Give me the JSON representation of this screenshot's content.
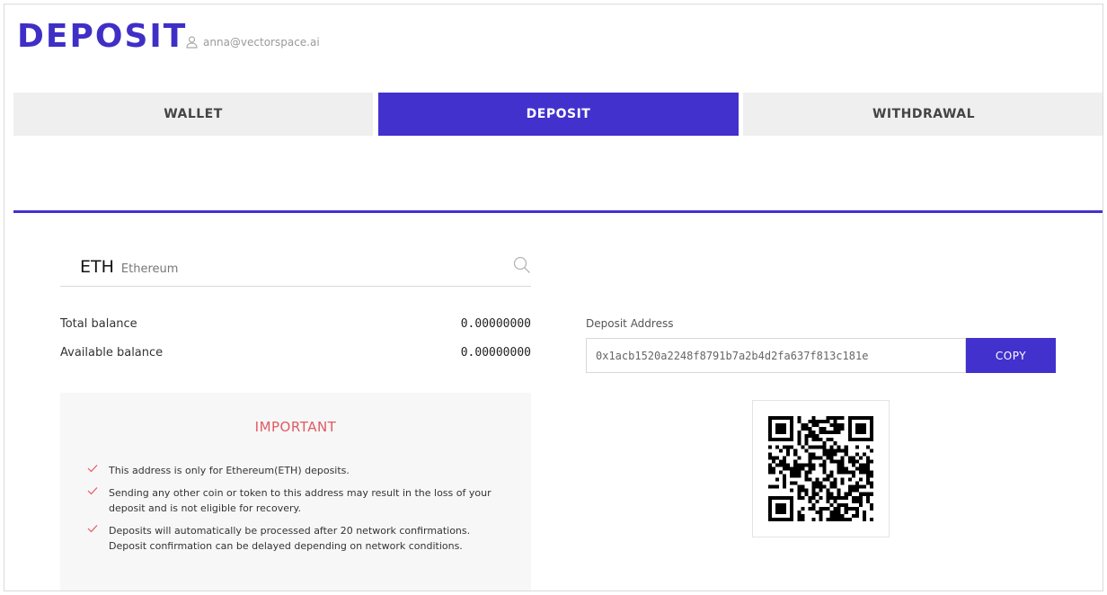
{
  "header": {
    "title": "DEPOSIT",
    "user_email": "anna@vectorspace.ai"
  },
  "tabs": [
    {
      "label": "WALLET",
      "active": false
    },
    {
      "label": "DEPOSIT",
      "active": true
    },
    {
      "label": "WITHDRAWAL",
      "active": false
    }
  ],
  "coin": {
    "symbol": "ETH",
    "name": "Ethereum"
  },
  "balances": {
    "total_label": "Total balance",
    "total_value": "0.00000000",
    "available_label": "Available balance",
    "available_value": "0.00000000"
  },
  "important": {
    "title": "IMPORTANT",
    "items": [
      "This address is only for Ethereum(ETH) deposits.",
      "Sending any other coin or token to this address may result in the loss of your deposit and is not eligible for recovery.",
      "Deposits will automatically be processed after 20 network confirmations. Deposit confirmation can be delayed depending on network conditions."
    ]
  },
  "deposit": {
    "address_label": "Deposit Address",
    "address_value": "0x1acb1520a2248f8791b7a2b4d2fa637f813c181e",
    "copy_label": "COPY"
  },
  "colors": {
    "accent": "#4231cd",
    "important": "#e05a63"
  }
}
